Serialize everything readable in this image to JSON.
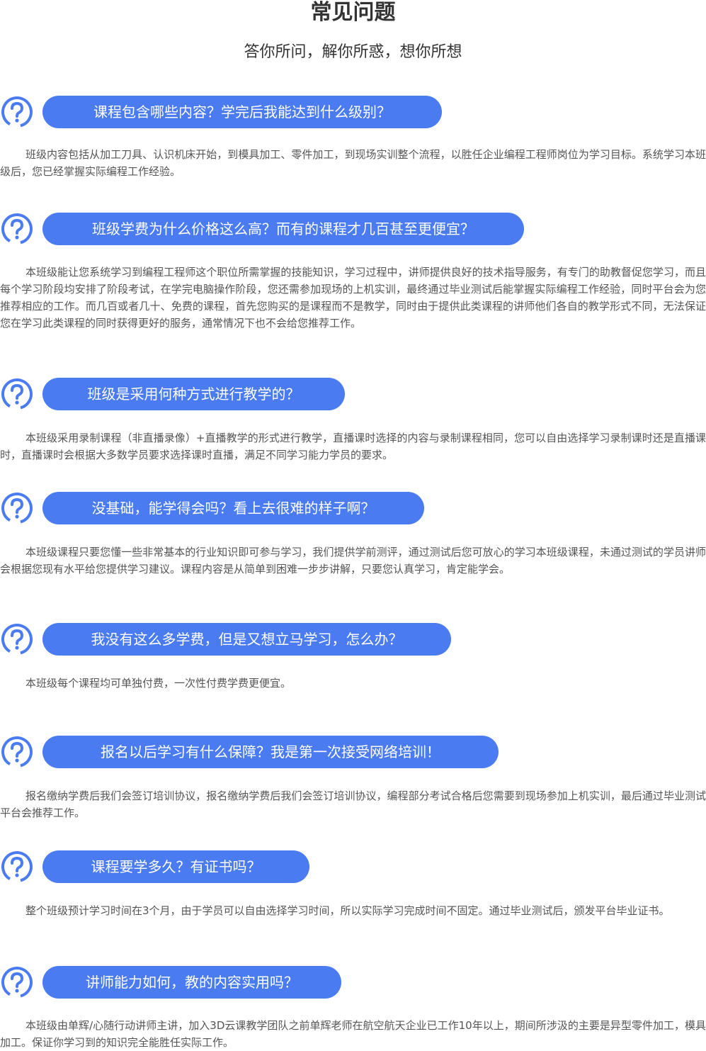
{
  "header": {
    "title": "常见问题",
    "subtitle": "答你所问，解你所惑，想你所想"
  },
  "colors": {
    "accent": "#4a7bf0",
    "icon": "#4a7bf0"
  },
  "faq": [
    {
      "question": "课程包含哪些内容？学完后我能达到什么级别？",
      "answer": "班级内容包括从加工刀具、认识机床开始，到模具加工、零件加工，到现场实训整个流程，以胜任企业编程工程师岗位为学习目标。系统学习本班级后，您已经掌握实际编程工作经验。"
    },
    {
      "question": "班级学费为什么价格这么高？而有的课程才几百甚至更便宜？",
      "answer": "本班级能让您系统学习到编程工程师这个职位所需掌握的技能知识，学习过程中，讲师提供良好的技术指导服务，有专门的助教督促您学习，而且每个学习阶段均安排了阶段考试，在学完电脑操作阶段，您还需参加现场的上机实训，最终通过毕业测试后能掌握实际编程工作经验，同时平台会为您推荐相应的工作。而几百或者几十、免费的课程，首先您购买的是课程而不是教学，同时由于提供此类课程的讲师他们各自的教学形式不同，无法保证您在学习此类课程的同时获得更好的服务，通常情况下也不会给您推荐工作。"
    },
    {
      "question": "班级是采用何种方式进行教学的？",
      "answer": "本班级采用录制课程（非直播录像）+直播教学的形式进行教学，直播课时选择的内容与录制课程相同，您可以自由选择学习录制课时还是直播课时，直播课时会根据大多数学员要求选择课时直播，满足不同学习能力学员的要求。"
    },
    {
      "question": "没基础，能学得会吗？看上去很难的样子啊？",
      "answer": "本班级课程只要您懂一些非常基本的行业知识即可参与学习，我们提供学前测评，通过测试后您可放心的学习本班级课程，未通过测试的学员讲师会根据您现有水平给您提供学习建议。课程内容是从简单到困难一步步讲解，只要您认真学习，肯定能学会。"
    },
    {
      "question": "我没有这么多学费，但是又想立马学习，怎么办？",
      "answer": "本班级每个课程均可单独付费，一次性付费学费更便宜。"
    },
    {
      "question": "报名以后学习有什么保障？我是第一次接受网络培训！",
      "answer": "报名缴纳学费后我们会签订培训协议，报名缴纳学费后我们会签订培训协议，编程部分考试合格后您需要到现场参加上机实训，最后通过毕业测试平台会推荐工作。"
    },
    {
      "question": "课程要学多久？有证书吗？",
      "answer": "整个班级预计学习时间在3个月，由于学员可以自由选择学习时间，所以实际学习完成时间不固定。通过毕业测试后，颁发平台毕业证书。"
    },
    {
      "question": "讲师能力如何，教的内容实用吗？",
      "answer": "本班级由单辉/心随行动讲师主讲，加入3D云课教学团队之前单辉老师在航空航天企业已工作10年以上，期间所涉汲的主要是异型零件加工，模具加工。保证你学习到的知识完全能胜任实际工作。"
    }
  ]
}
